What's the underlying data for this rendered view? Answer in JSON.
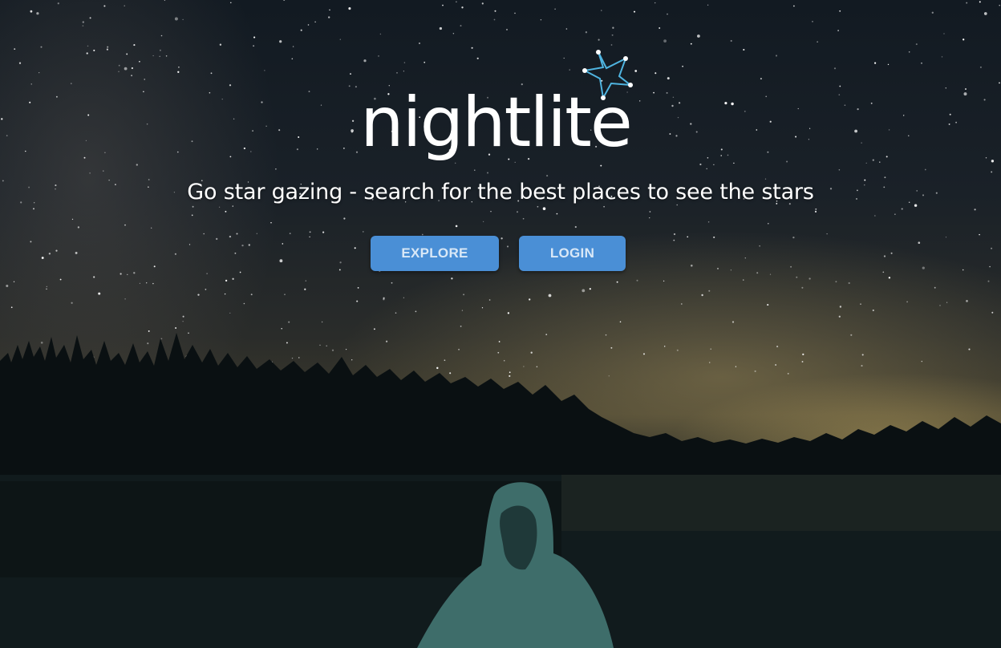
{
  "logo": {
    "text": "nightlite",
    "color": "#ffffff",
    "star_color": "#4fb4e0"
  },
  "hero": {
    "tagline": "Go star gazing - search for the best places to see the stars"
  },
  "buttons": {
    "explore_label": "EXPLORE",
    "login_label": "LOGIN",
    "color": "#4a8fd6"
  },
  "icons": {
    "logo_star": "constellation-star-icon"
  }
}
